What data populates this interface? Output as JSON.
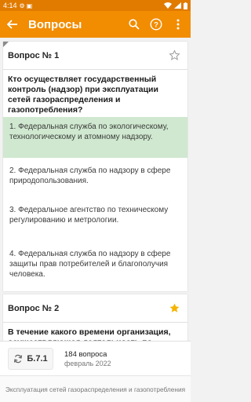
{
  "status_bar": {
    "time": "4:14"
  },
  "app_bar": {
    "title": "Вопросы"
  },
  "questions": [
    {
      "number_label": "Вопрос № 1",
      "starred": false,
      "text": "Кто осуществляет государственный контроль (надзор) при эксплуатации сетей газораспределения и газопотребления?",
      "answers": [
        {
          "text": "1. Федеральная служба по экологическому, технологическому и атомному надзору.",
          "correct": true
        },
        {
          "text": "2. Федеральная служба по надзору в сфере природопользования.",
          "correct": false
        },
        {
          "text": "3. Федеральное агентство по техническому регулированию и метрологии.",
          "correct": false
        },
        {
          "text": "4. Федеральная служба по надзору в сфере защиты прав потребителей и благополучия человека.",
          "correct": false
        }
      ]
    },
    {
      "number_label": "Вопрос № 2",
      "starred": true,
      "text": "В течение какого времени организация, осуществляющая деятельность по"
    }
  ],
  "bottom_bar": {
    "version": "Б.7.1",
    "count": "184 вопроса",
    "date": "февраль 2022"
  },
  "footer": {
    "text": "Эксплуатация сетей газораспределения и газопотребления"
  },
  "colors": {
    "app_bar": "#f28c00",
    "status_bar": "#e07b00",
    "correct_answer_bg": "#cfe8cf",
    "star_active": "#f5b400"
  }
}
